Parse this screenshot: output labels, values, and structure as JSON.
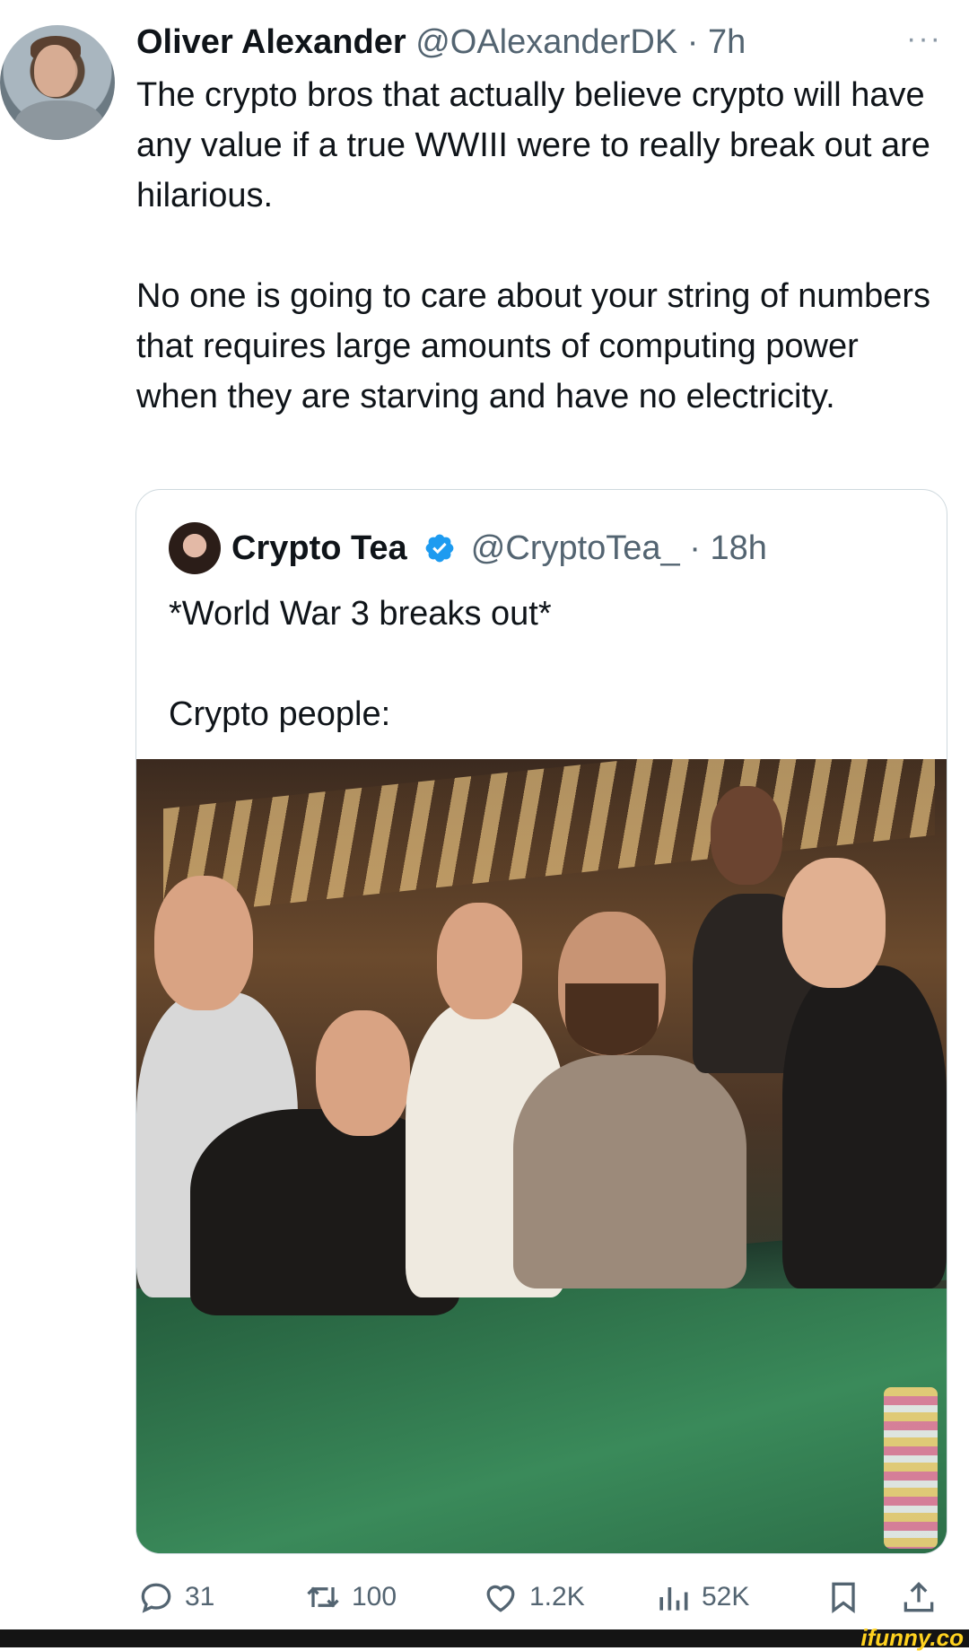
{
  "tweet": {
    "author_name": "Oliver Alexander",
    "author_handle": "@OAlexanderDK",
    "separator": "·",
    "time": "7h",
    "more_label": "···",
    "text_paragraph_1": "The crypto bros that actually believe crypto will have any value if a true WWIII were to really break out are hilarious.",
    "text_paragraph_2": "No one is going to care about your string of numbers that requires large amounts of computing power when they are starving and have no electricity."
  },
  "quoted_tweet": {
    "author_name": "Crypto Tea",
    "verified": true,
    "author_handle": "@CryptoTea_",
    "separator": "·",
    "time": "18h",
    "text_line_1": "*World War 3 breaks out*",
    "text_line_2": "Crypto people:"
  },
  "actions": {
    "replies": "31",
    "retweets": "100",
    "likes": "1.2K",
    "views": "52K"
  },
  "icons": {
    "reply": "reply-icon",
    "retweet": "retweet-icon",
    "like": "heart-icon",
    "views": "views-chart-icon",
    "bookmark": "bookmark-icon",
    "share": "share-icon",
    "verified": "verified-badge-icon",
    "more": "more-icon"
  },
  "colors": {
    "verified_blue": "#1d9bf0",
    "muted_text": "#536471",
    "watermark_yellow": "#ffd21f"
  },
  "watermark": "ifunny.co"
}
